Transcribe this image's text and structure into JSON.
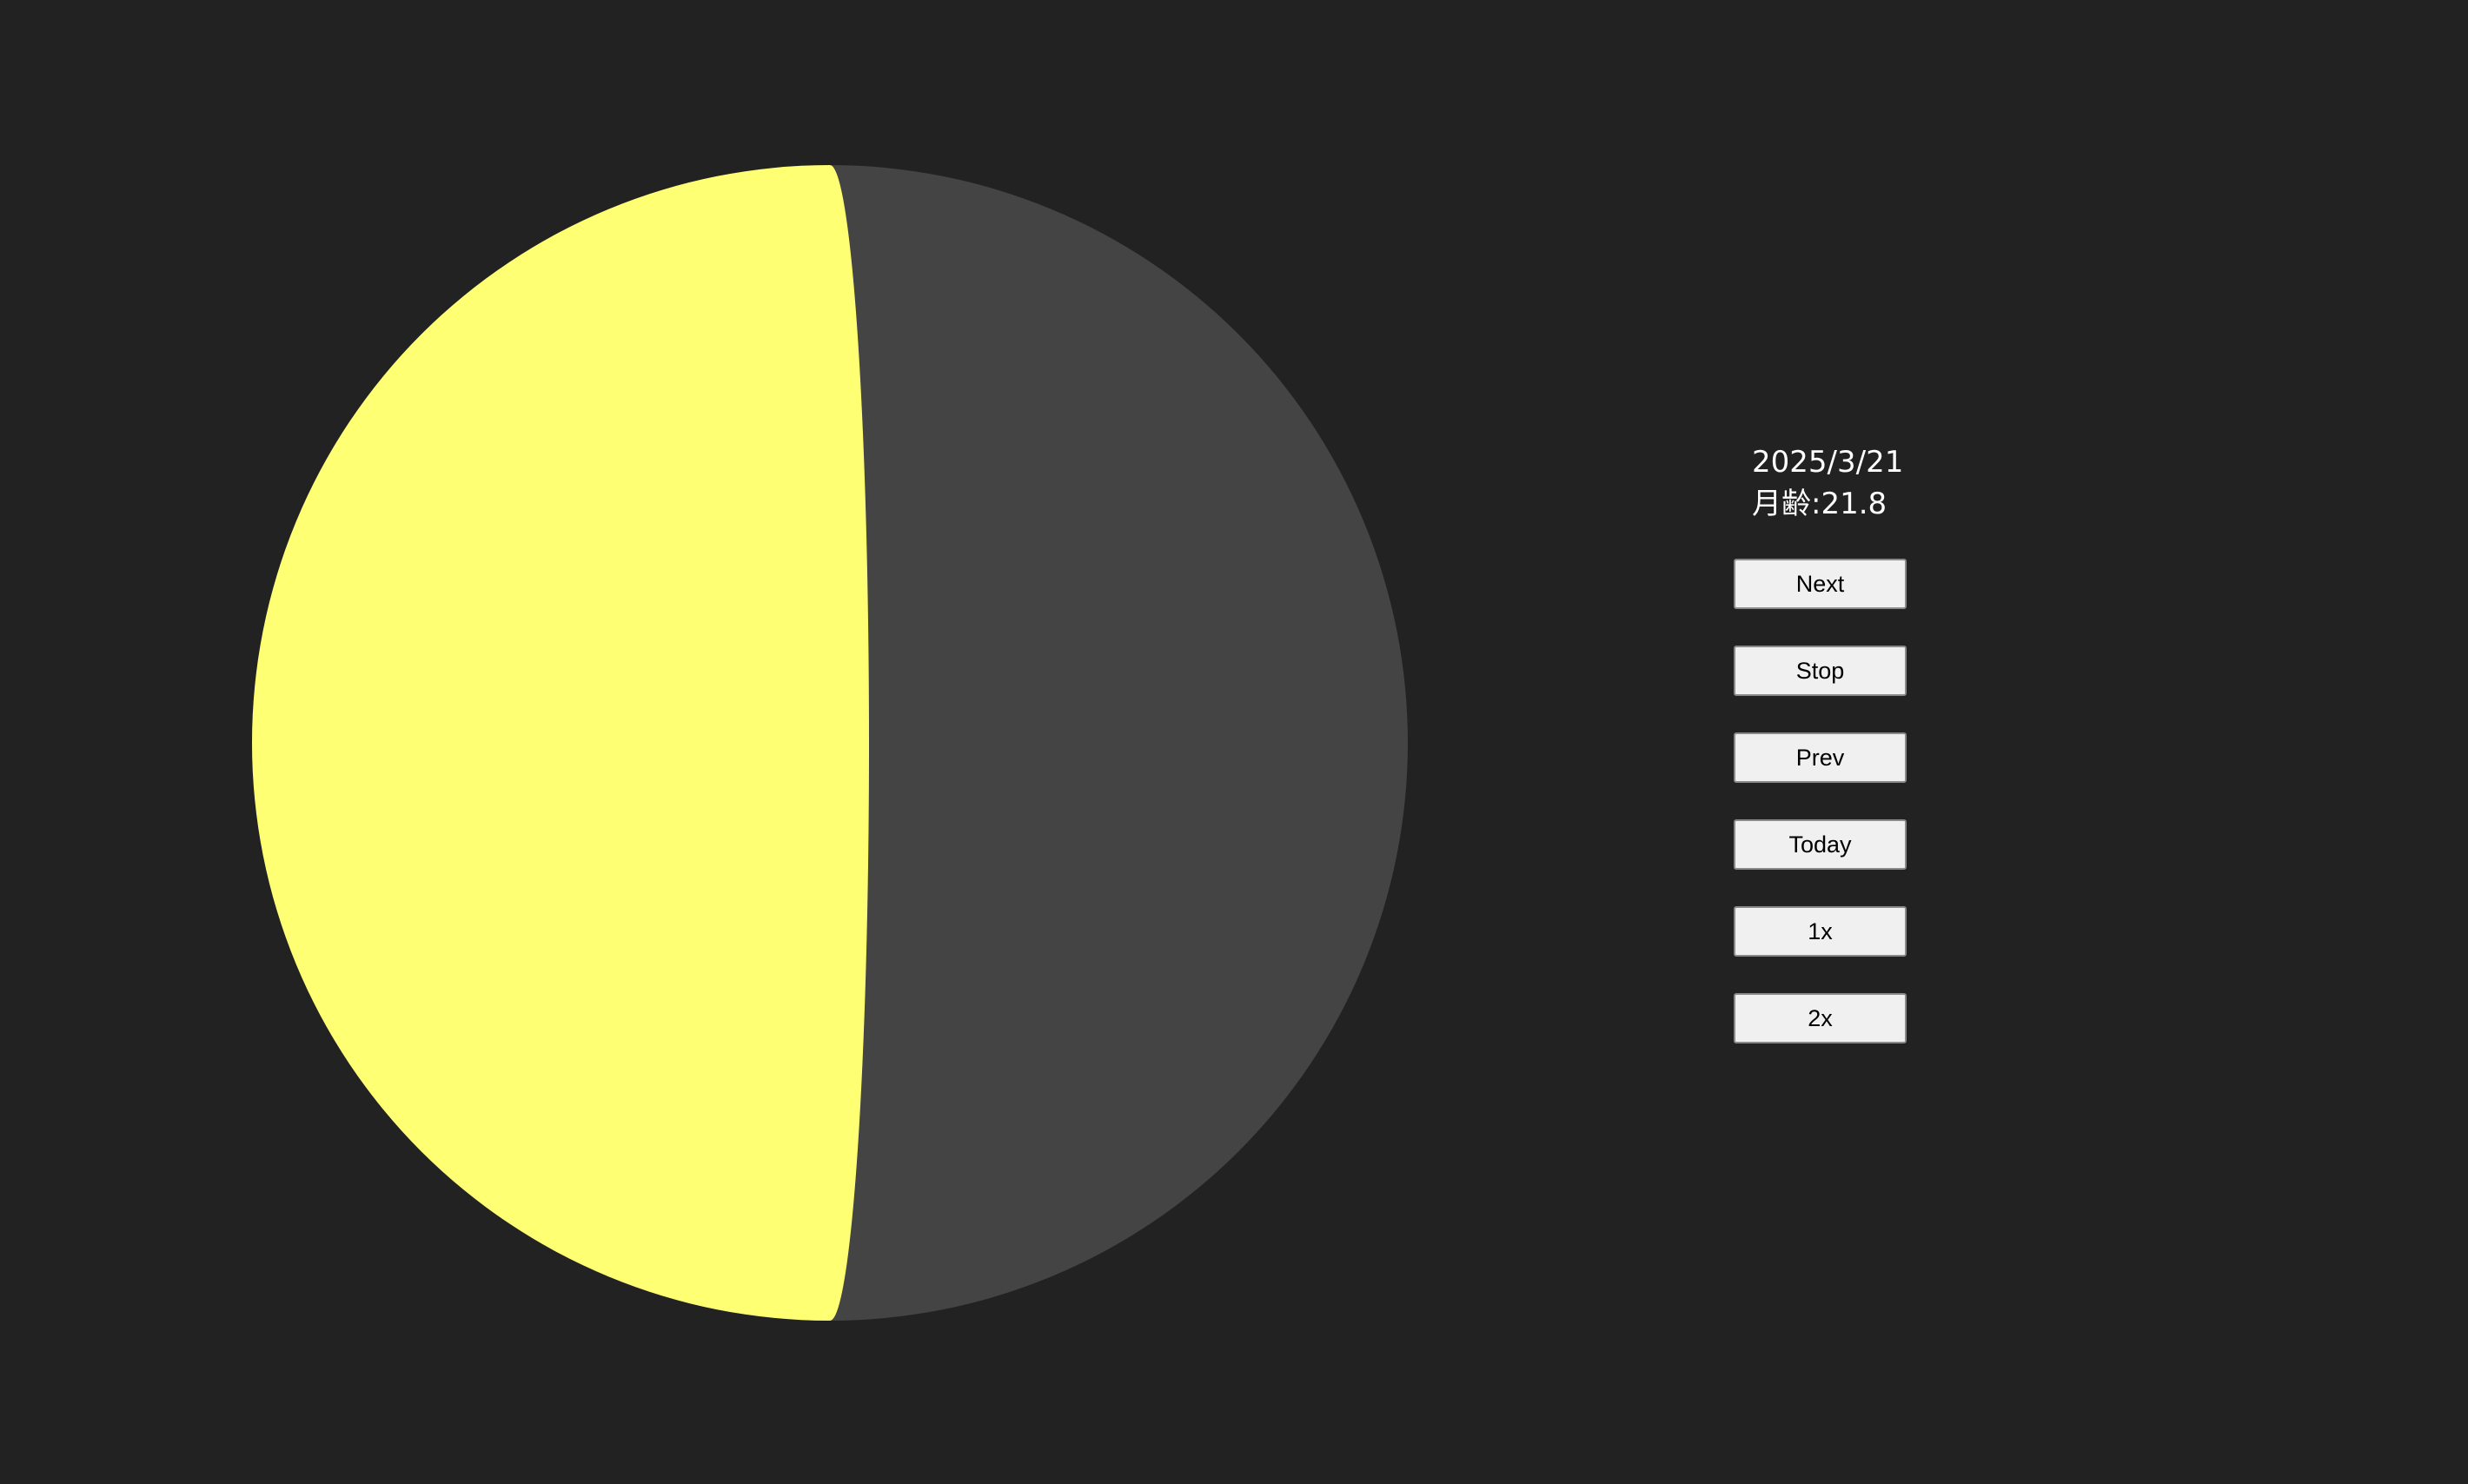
{
  "date": "2025/3/21",
  "moon_age_label": "月齢:21.8",
  "moon_age": 21.8,
  "colors": {
    "background": "#222222",
    "lit": "#ffff73",
    "shadow": "#444444"
  },
  "buttons": {
    "next": "Next",
    "stop": "Stop",
    "prev": "Prev",
    "today": "Today",
    "speed_1x": "1x",
    "speed_2x": "2x"
  }
}
